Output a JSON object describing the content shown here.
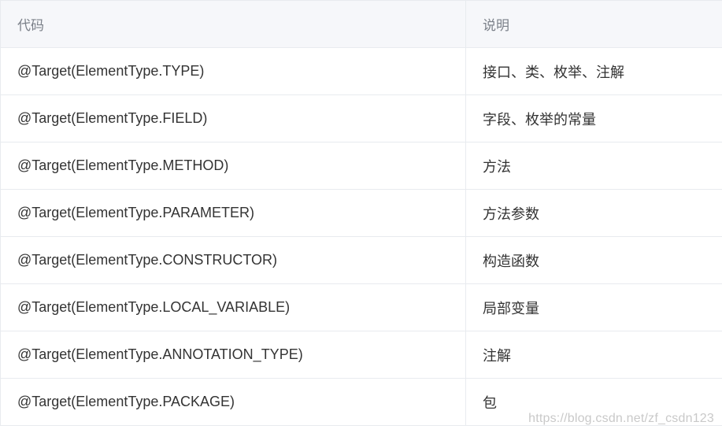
{
  "table": {
    "headers": [
      "代码",
      "说明"
    ],
    "rows": [
      [
        "@Target(ElementType.TYPE)",
        "接口、类、枚举、注解"
      ],
      [
        "@Target(ElementType.FIELD)",
        "字段、枚举的常量"
      ],
      [
        "@Target(ElementType.METHOD)",
        "方法"
      ],
      [
        "@Target(ElementType.PARAMETER)",
        "方法参数"
      ],
      [
        "@Target(ElementType.CONSTRUCTOR)",
        "构造函数"
      ],
      [
        "@Target(ElementType.LOCAL_VARIABLE)",
        "局部变量"
      ],
      [
        "@Target(ElementType.ANNOTATION_TYPE)",
        "注解"
      ],
      [
        "@Target(ElementType.PACKAGE)",
        "包"
      ]
    ]
  },
  "watermark": "https://blog.csdn.net/zf_csdn123",
  "colors": {
    "header_bg": "#f6f7fa",
    "header_text": "#7b8089",
    "cell_text": "#333333",
    "border": "#e8ebef",
    "watermark": "#c9c9c9"
  }
}
